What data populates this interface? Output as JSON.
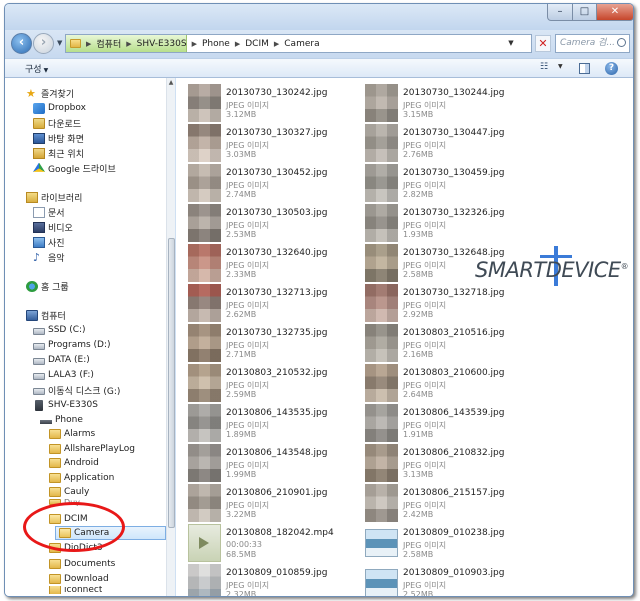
{
  "window": {
    "controls": {
      "minimize": "–",
      "maximize": "□",
      "close": "✕"
    }
  },
  "address": {
    "crumbs": [
      "컴퓨터",
      "SHV-E330S",
      "Phone",
      "DCIM",
      "Camera"
    ],
    "search_placeholder": "Camera 검..."
  },
  "toolbar": {
    "organize": "구성"
  },
  "sidebar": {
    "favorites": {
      "label": "즐겨찾기",
      "items": [
        "Dropbox",
        "다운로드",
        "바탕 화면",
        "최근 위치",
        "Google 드라이브"
      ]
    },
    "libraries": {
      "label": "라이브러리",
      "items": [
        "문서",
        "비디오",
        "사진",
        "음악"
      ]
    },
    "homegroup": "홈 그룹",
    "computer": {
      "label": "컴퓨터",
      "drives": [
        "SSD (C:)",
        "Programs (D:)",
        "DATA (E:)",
        "LALA3 (F:)",
        "이동식 디스크 (G:)",
        "SHV-E330S"
      ],
      "phone": "Phone",
      "folders": [
        "Alarms",
        "AllsharePlayLog",
        "Android",
        "Application",
        "Cauly",
        "DCIM",
        "Camera",
        "DioDict3",
        "Documents",
        "Download",
        "iconnect"
      ],
      "partial_folder": "Duy..."
    }
  },
  "files": [
    {
      "name": "20130730_130242.jpg",
      "type": "JPEG 이미지",
      "size": "3.12MB",
      "kind": "jpg",
      "colors": [
        "#b4a8a0",
        "#8a847e",
        "#cfc6bd"
      ]
    },
    {
      "name": "20130730_130244.jpg",
      "type": "JPEG 이미지",
      "size": "3.15MB",
      "kind": "jpg",
      "colors": [
        "#a9a39b",
        "#bfb8b0",
        "#8d8982"
      ]
    },
    {
      "name": "20130730_130327.jpg",
      "type": "JPEG 이미지",
      "size": "3.03MB",
      "kind": "jpg",
      "colors": [
        "#8a7a70",
        "#c2b2a6",
        "#e3d7cd"
      ]
    },
    {
      "name": "20130730_130447.jpg",
      "type": "JPEG 이미지",
      "size": "2.76MB",
      "kind": "jpg",
      "colors": [
        "#b7b3ad",
        "#9b9892",
        "#c5c1bb"
      ]
    },
    {
      "name": "20130730_130452.jpg",
      "type": "JPEG 이미지",
      "size": "2.74MB",
      "kind": "jpg",
      "colors": [
        "#c6bcb2",
        "#a59b92",
        "#d8cec4"
      ]
    },
    {
      "name": "20130730_130459.jpg",
      "type": "JPEG 이미지",
      "size": "2.82MB",
      "kind": "jpg",
      "colors": [
        "#aaa9a4",
        "#8f8f89",
        "#c8c7c2"
      ]
    },
    {
      "name": "20130730_130503.jpg",
      "type": "JPEG 이미지",
      "size": "2.53MB",
      "kind": "jpg",
      "colors": [
        "#918a84",
        "#b9b1aa",
        "#7d7670"
      ]
    },
    {
      "name": "20130730_132326.jpg",
      "type": "JPEG 이미지",
      "size": "1.93MB",
      "kind": "jpg",
      "colors": [
        "#a7a59f",
        "#8c8a84",
        "#c4c2bc"
      ]
    },
    {
      "name": "20130730_132640.jpg",
      "type": "JPEG 이미지",
      "size": "2.33MB",
      "kind": "jpg",
      "colors": [
        "#b5675a",
        "#cc8d7f",
        "#d9b7a9"
      ]
    },
    {
      "name": "20130730_132648.jpg",
      "type": "JPEG 이미지",
      "size": "2.58MB",
      "kind": "jpg",
      "colors": [
        "#a39781",
        "#c2b49c",
        "#7f7767"
      ]
    },
    {
      "name": "20130730_132713.jpg",
      "type": "JPEG 이미지",
      "size": "2.62MB",
      "kind": "jpg",
      "colors": [
        "#b1564c",
        "#8c7b74",
        "#c7b9b0"
      ]
    },
    {
      "name": "20130730_132718.jpg",
      "type": "JPEG 이미지",
      "size": "2.92MB",
      "kind": "jpg",
      "colors": [
        "#9a6c63",
        "#b88d85",
        "#d2b8af"
      ]
    },
    {
      "name": "20130730_132735.jpg",
      "type": "JPEG 이미지",
      "size": "2.71MB",
      "kind": "jpg",
      "colors": [
        "#9f8a76",
        "#c2ad97",
        "#847260"
      ]
    },
    {
      "name": "20130803_210516.jpg",
      "type": "JPEG 이미지",
      "size": "2.16MB",
      "kind": "jpg",
      "colors": [
        "#8c8982",
        "#aaa79f",
        "#c6c3bc"
      ]
    },
    {
      "name": "20130803_210532.jpg",
      "type": "JPEG 이미지",
      "size": "2.59MB",
      "kind": "jpg",
      "colors": [
        "#b09c85",
        "#d1c0ab",
        "#948371"
      ]
    },
    {
      "name": "20130803_210600.jpg",
      "type": "JPEG 이미지",
      "size": "2.64MB",
      "kind": "jpg",
      "colors": [
        "#b5a18c",
        "#8d7e6f",
        "#cdbfae"
      ]
    },
    {
      "name": "20130806_143535.jpg",
      "type": "JPEG 이미지",
      "size": "1.89MB",
      "kind": "jpg",
      "colors": [
        "#a8a8a6",
        "#8b8b89",
        "#c5c5c3"
      ]
    },
    {
      "name": "20130806_143539.jpg",
      "type": "JPEG 이미지",
      "size": "1.91MB",
      "kind": "jpg",
      "colors": [
        "#9e9d9a",
        "#b9b8b5",
        "#878683"
      ]
    },
    {
      "name": "20130806_143548.jpg",
      "type": "JPEG 이미지",
      "size": "1.99MB",
      "kind": "jpg",
      "colors": [
        "#9a9794",
        "#b7b4b0",
        "#7e7b78"
      ]
    },
    {
      "name": "20130806_210832.jpg",
      "type": "JPEG 이미지",
      "size": "3.13MB",
      "kind": "jpg",
      "colors": [
        "#a09282",
        "#c0b2a2",
        "#857868"
      ]
    },
    {
      "name": "20130806_210901.jpg",
      "type": "JPEG 이미지",
      "size": "3.22MB",
      "kind": "jpg",
      "colors": [
        "#bdb5ac",
        "#9a938b",
        "#d5cec6"
      ]
    },
    {
      "name": "20130806_215157.jpg",
      "type": "JPEG 이미지",
      "size": "2.42MB",
      "kind": "jpg",
      "colors": [
        "#b4aea6",
        "#d0cbc4",
        "#958f88"
      ]
    },
    {
      "name": "20130808_182042.mp4",
      "type": "00:00:33",
      "size": "68.5MB",
      "kind": "video"
    },
    {
      "name": "20130809_010238.jpg",
      "type": "JPEG 이미지",
      "size": "2.58MB",
      "kind": "photo"
    },
    {
      "name": "20130809_010859.jpg",
      "type": "JPEG 이미지",
      "size": "2.32MB",
      "kind": "jpg",
      "colors": [
        "#e5e7e9",
        "#c9ced3",
        "#a8b7c3"
      ]
    },
    {
      "name": "20130809_010903.jpg",
      "type": "JPEG 이미지",
      "size": "2.52MB",
      "kind": "photo"
    }
  ],
  "watermark": {
    "text": "SMARTDEVICE",
    "mark": "®"
  }
}
